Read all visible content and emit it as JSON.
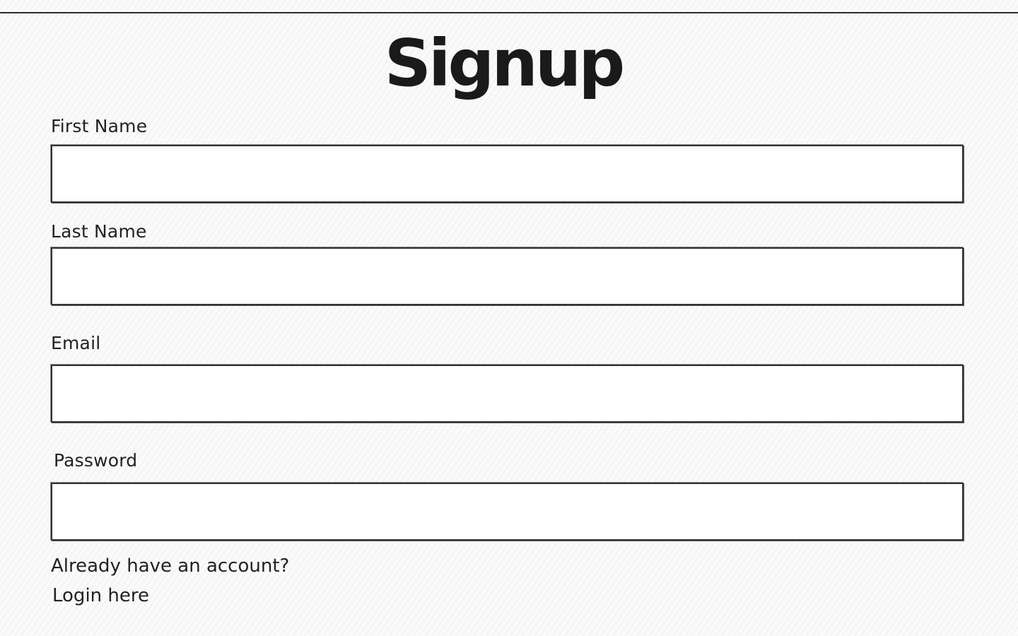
{
  "form": {
    "title": "Signup",
    "fields": [
      {
        "label": "First Name",
        "value": "",
        "placeholder": ""
      },
      {
        "label": "Last Name",
        "value": "",
        "placeholder": ""
      },
      {
        "label": "Email",
        "value": "",
        "placeholder": ""
      },
      {
        "label": "Password",
        "value": "",
        "placeholder": ""
      }
    ],
    "footer": {
      "prompt": "Already have an account?",
      "link_label": "Login here"
    }
  }
}
